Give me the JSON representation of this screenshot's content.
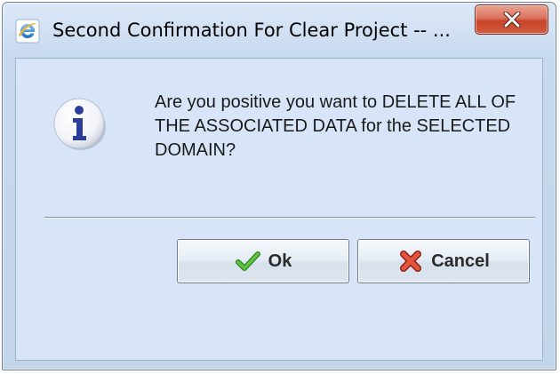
{
  "window": {
    "title": "Second Confirmation For Clear Project -- ...",
    "app_icon": "ie-icon",
    "close_icon": "close-icon"
  },
  "dialog": {
    "icon": "info-icon",
    "message": "Are you positive you want to DELETE ALL OF THE ASSOCIATED DATA for the SELECTED DOMAIN?",
    "buttons": {
      "ok_label": "Ok",
      "ok_icon": "checkmark-icon",
      "cancel_label": "Cancel",
      "cancel_icon": "x-icon"
    }
  },
  "colors": {
    "client_background": "#d8e5f8",
    "close_button": "#c8442a",
    "checkmark": "#3ea02a",
    "cancel_x": "#d9402a",
    "info_i": "#2b3f9a"
  }
}
